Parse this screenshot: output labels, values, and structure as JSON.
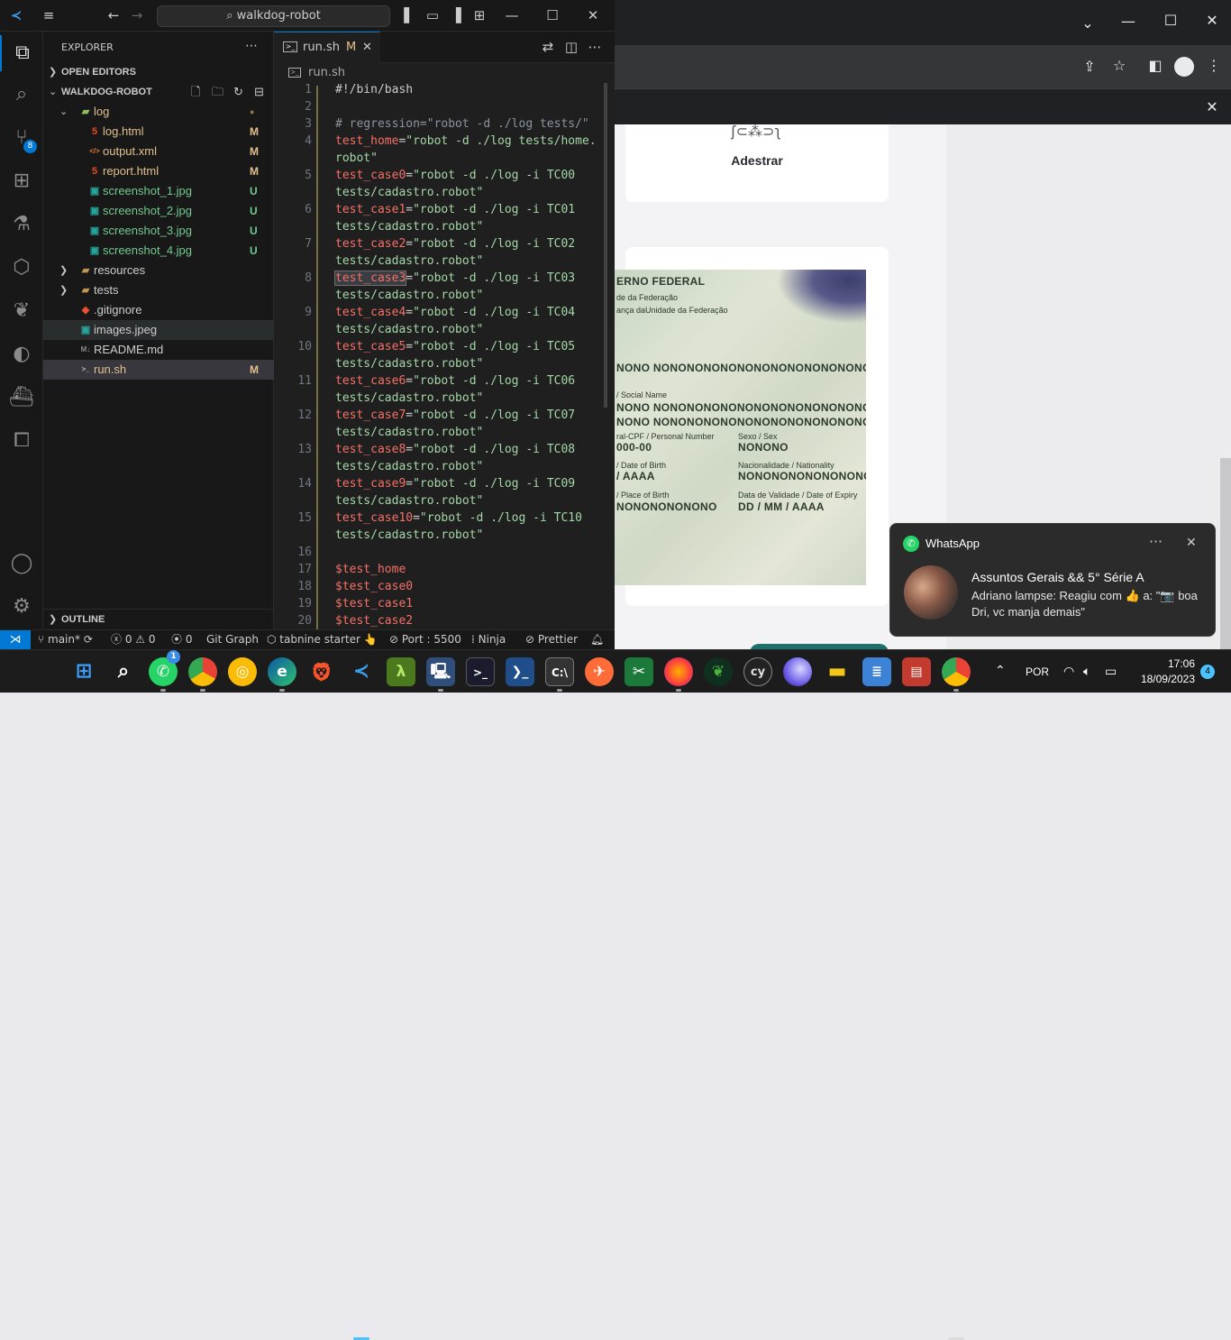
{
  "vscode": {
    "search_text": "walkdog-robot",
    "explorer_title": "EXPLORER",
    "open_editors": "OPEN EDITORS",
    "project": "WALKDOG-ROBOT",
    "outline": "OUTLINE",
    "scm_badge": "8",
    "tree": [
      {
        "name": "log",
        "status": "",
        "type": "folder-open"
      },
      {
        "name": "log.html",
        "status": "M",
        "type": "html"
      },
      {
        "name": "output.xml",
        "status": "M",
        "type": "xml"
      },
      {
        "name": "report.html",
        "status": "M",
        "type": "html"
      },
      {
        "name": "screenshot_1.jpg",
        "status": "U",
        "type": "image"
      },
      {
        "name": "screenshot_2.jpg",
        "status": "U",
        "type": "image"
      },
      {
        "name": "screenshot_3.jpg",
        "status": "U",
        "type": "image"
      },
      {
        "name": "screenshot_4.jpg",
        "status": "U",
        "type": "image"
      },
      {
        "name": "resources",
        "status": "",
        "type": "folder"
      },
      {
        "name": "tests",
        "status": "",
        "type": "folder"
      },
      {
        "name": ".gitignore",
        "status": "",
        "type": "git"
      },
      {
        "name": "images.jpeg",
        "status": "",
        "type": "image"
      },
      {
        "name": "README.md",
        "status": "",
        "type": "md"
      },
      {
        "name": "run.sh",
        "status": "M",
        "type": "shell"
      }
    ],
    "tab": {
      "name": "run.sh",
      "status": "M"
    },
    "breadcrumb": "run.sh",
    "code": [
      {
        "n": "1",
        "parts": [
          {
            "c": "plain",
            "t": "#!/bin/bash"
          }
        ]
      },
      {
        "n": "2",
        "parts": []
      },
      {
        "n": "3",
        "parts": [
          {
            "c": "cmt",
            "t": "# regression=\"robot -d ./log tests/\""
          }
        ]
      },
      {
        "n": "4",
        "parts": [
          {
            "c": "var",
            "t": "test_home"
          },
          {
            "c": "plain",
            "t": "="
          },
          {
            "c": "str",
            "t": "\"robot -d ./log tests/home."
          }
        ]
      },
      {
        "n": "",
        "parts": [
          {
            "c": "str",
            "t": "robot\""
          }
        ]
      },
      {
        "n": "5",
        "parts": [
          {
            "c": "var",
            "t": "test_case0"
          },
          {
            "c": "plain",
            "t": "="
          },
          {
            "c": "str",
            "t": "\"robot -d ./log -i TC00"
          }
        ]
      },
      {
        "n": "",
        "parts": [
          {
            "c": "str",
            "t": "tests/cadastro.robot\""
          }
        ]
      },
      {
        "n": "6",
        "parts": [
          {
            "c": "var",
            "t": "test_case1"
          },
          {
            "c": "plain",
            "t": "="
          },
          {
            "c": "str",
            "t": "\"robot -d ./log -i TC01"
          }
        ]
      },
      {
        "n": "",
        "parts": [
          {
            "c": "str",
            "t": "tests/cadastro.robot\""
          }
        ]
      },
      {
        "n": "7",
        "parts": [
          {
            "c": "var",
            "t": "test_case2"
          },
          {
            "c": "plain",
            "t": "="
          },
          {
            "c": "str",
            "t": "\"robot -d ./log -i TC02"
          }
        ]
      },
      {
        "n": "",
        "parts": [
          {
            "c": "str",
            "t": "tests/cadastro.robot\""
          }
        ]
      },
      {
        "n": "8",
        "parts": [
          {
            "c": "var sel-word",
            "t": "test_case3"
          },
          {
            "c": "plain",
            "t": "="
          },
          {
            "c": "str",
            "t": "\"robot -d ./log -i TC03"
          }
        ]
      },
      {
        "n": "",
        "parts": [
          {
            "c": "str",
            "t": "tests/cadastro.robot\""
          }
        ]
      },
      {
        "n": "9",
        "parts": [
          {
            "c": "var",
            "t": "test_case4"
          },
          {
            "c": "plain",
            "t": "="
          },
          {
            "c": "str",
            "t": "\"robot -d ./log -i TC04"
          }
        ]
      },
      {
        "n": "",
        "parts": [
          {
            "c": "str",
            "t": "tests/cadastro.robot\""
          }
        ]
      },
      {
        "n": "10",
        "parts": [
          {
            "c": "var",
            "t": "test_case5"
          },
          {
            "c": "plain",
            "t": "="
          },
          {
            "c": "str",
            "t": "\"robot -d ./log -i TC05"
          }
        ]
      },
      {
        "n": "",
        "parts": [
          {
            "c": "str",
            "t": "tests/cadastro.robot\""
          }
        ]
      },
      {
        "n": "11",
        "parts": [
          {
            "c": "var",
            "t": "test_case6"
          },
          {
            "c": "plain",
            "t": "="
          },
          {
            "c": "str",
            "t": "\"robot -d ./log -i TC06"
          }
        ]
      },
      {
        "n": "",
        "parts": [
          {
            "c": "str",
            "t": "tests/cadastro.robot\""
          }
        ]
      },
      {
        "n": "12",
        "parts": [
          {
            "c": "var",
            "t": "test_case7"
          },
          {
            "c": "plain",
            "t": "="
          },
          {
            "c": "str",
            "t": "\"robot -d ./log -i TC07"
          }
        ]
      },
      {
        "n": "",
        "parts": [
          {
            "c": "str",
            "t": "tests/cadastro.robot\""
          }
        ]
      },
      {
        "n": "13",
        "parts": [
          {
            "c": "var",
            "t": "test_case8"
          },
          {
            "c": "plain",
            "t": "="
          },
          {
            "c": "str",
            "t": "\"robot -d ./log -i TC08"
          }
        ]
      },
      {
        "n": "",
        "parts": [
          {
            "c": "str",
            "t": "tests/cadastro.robot\""
          }
        ]
      },
      {
        "n": "14",
        "parts": [
          {
            "c": "var",
            "t": "test_case9"
          },
          {
            "c": "plain",
            "t": "="
          },
          {
            "c": "str",
            "t": "\"robot -d ./log -i TC09"
          }
        ]
      },
      {
        "n": "",
        "parts": [
          {
            "c": "str",
            "t": "tests/cadastro.robot\""
          }
        ]
      },
      {
        "n": "15",
        "parts": [
          {
            "c": "var",
            "t": "test_case10"
          },
          {
            "c": "plain",
            "t": "="
          },
          {
            "c": "str",
            "t": "\"robot -d ./log -i TC10"
          }
        ]
      },
      {
        "n": "",
        "parts": [
          {
            "c": "str",
            "t": "tests/cadastro.robot\""
          }
        ]
      },
      {
        "n": "16",
        "parts": []
      },
      {
        "n": "17",
        "parts": [
          {
            "c": "var",
            "t": "$test_home"
          }
        ]
      },
      {
        "n": "18",
        "parts": [
          {
            "c": "var",
            "t": "$test_case0"
          }
        ]
      },
      {
        "n": "19",
        "parts": [
          {
            "c": "var",
            "t": "$test_case1"
          }
        ]
      },
      {
        "n": "20",
        "parts": [
          {
            "c": "var",
            "t": "$test_case2"
          }
        ]
      }
    ],
    "status": {
      "branch": "main*",
      "errors": "0",
      "warnings": "0",
      "ports": "0",
      "git_graph": "Git Graph",
      "tabnine": "tabnine starter",
      "port": "Port : 5500",
      "ninja": "Ninja",
      "prettier": "Prettier"
    }
  },
  "browser": {
    "card_label": "Adestrar",
    "id_lines": [
      "ERNO FEDERAL",
      "de da Federação",
      "ança daUnidade da Federação",
      "NONO NONONONONONONONONONONONONONO",
      "/ Social Name",
      "NONO NONONONONONONONONONONONONONO",
      "NONO NONONONONONONONONONONONONONO",
      "ral-CPF / Personal Number",
      "Sexo / Sex",
      "000-00",
      "NONONO",
      "/ Date of Birth",
      "Nacionalidade / Nationality",
      "/ AAAA",
      "NONONONONONONONONO",
      "/ Place of Birth",
      "Data de Validade / Date of Expiry",
      "NONONONONONO",
      "DD / MM / AAAA"
    ]
  },
  "notification": {
    "app": "WhatsApp",
    "title": "Assuntos Gerais && 5° Série A",
    "message": "Adriano lampse: Reagiu com 👍 a: \"📷 boa Dri, vc manja demais\""
  },
  "taskbar": {
    "whatsapp_badge": "1",
    "language": "POR",
    "time": "17:06",
    "date": "18/09/2023",
    "notification_count": "4"
  },
  "colors": {
    "accent": "#0078d4",
    "modified": "#e2c08d",
    "untracked": "#73c991",
    "variable": "#f47067",
    "string": "#a5d6a7"
  }
}
